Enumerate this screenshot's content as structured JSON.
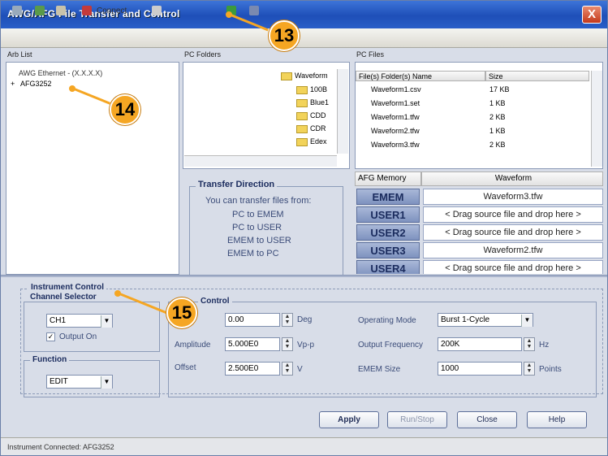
{
  "window": {
    "title": "AWG/AFG File Transfer and Control",
    "close_label": "X"
  },
  "toolbar": {
    "connect_label": "Connect"
  },
  "panels": {
    "awg_list": {
      "header": "Arb List",
      "items": [
        "AWG Ethernet - (X.X.X.X)",
        "AFG3252"
      ]
    },
    "pc_folders": {
      "header": "PC Folders",
      "items": [
        "Waveform",
        "100B",
        "Blue1",
        "CDD",
        "CDR",
        "Edex"
      ]
    },
    "pc_files": {
      "header": "PC Files",
      "columns": [
        "File(s) Folder(s) Name",
        "Size"
      ],
      "rows": [
        [
          "Waveform1.csv",
          "17 KB"
        ],
        [
          "Waveform1.set",
          "1 KB"
        ],
        [
          "Waveform1.tfw",
          "2 KB"
        ],
        [
          "Waveform2.tfw",
          "1 KB"
        ],
        [
          "Waveform3.tfw",
          "2 KB"
        ]
      ]
    }
  },
  "transfer": {
    "title": "Transfer Direction",
    "intro": "You can transfer files from:",
    "lines": [
      "PC  to  EMEM",
      "PC  to  USER",
      "EMEM  to  USER",
      "EMEM  to  PC"
    ]
  },
  "afg_memory": {
    "header": "AFG Memory",
    "waveform_header": "Waveform",
    "rows": [
      {
        "name": "EMEM",
        "value": "Waveform3.tfw"
      },
      {
        "name": "USER1",
        "value": "< Drag source file and drop here >"
      },
      {
        "name": "USER2",
        "value": "< Drag source file and drop here >"
      },
      {
        "name": "USER3",
        "value": "Waveform2.tfw"
      },
      {
        "name": "USER4",
        "value": "< Drag source file and drop here >"
      }
    ]
  },
  "instrument": {
    "group_title": "Instrument Control",
    "channel_selector": "Channel Selector",
    "channel_value": "CH1",
    "output_on": "Output On",
    "function_title": "Function",
    "function_value": "EDIT",
    "control_title": "Control",
    "phase_value": "0.00",
    "phase_unit": "Deg",
    "amplitude_label": "Amplitude",
    "amplitude_value": "5.000E0",
    "amplitude_unit": "Vp-p",
    "offset_label": "Offset",
    "offset_value": "2.500E0",
    "offset_unit": "V",
    "mode_label": "Operating Mode",
    "mode_value": "Burst 1-Cycle",
    "freq_label": "Output Frequency",
    "freq_value": "200K",
    "freq_unit": "Hz",
    "emem_label": "EMEM Size",
    "emem_value": "1000",
    "emem_unit": "Points"
  },
  "buttons": {
    "apply": "Apply",
    "run_stop": "Run/Stop",
    "close": "Close",
    "help": "Help"
  },
  "status": {
    "text": "Instrument Connected: AFG3252"
  },
  "callouts": {
    "c13": "13",
    "c14": "14",
    "c15": "15"
  }
}
